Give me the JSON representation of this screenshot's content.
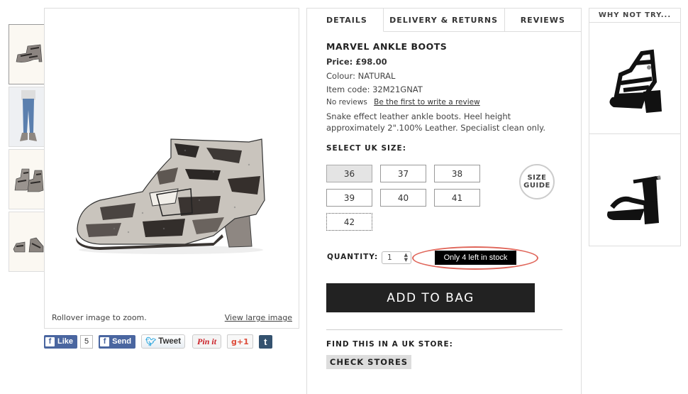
{
  "gallery": {
    "thumbnails": [
      {
        "name": "thumb-boot-side"
      },
      {
        "name": "thumb-model-legs"
      },
      {
        "name": "thumb-boot-pair"
      },
      {
        "name": "thumb-boot-front"
      }
    ],
    "rollover_text": "Rollover image to zoom.",
    "view_large_label": "View large image"
  },
  "social": {
    "like_label": "Like",
    "like_count": "5",
    "send_label": "Send",
    "tweet_label": "Tweet",
    "pin_label": "Pin it",
    "gplus_label": "g+1",
    "tumblr_label": "t"
  },
  "tabs": [
    "DETAILS",
    "DELIVERY & RETURNS",
    "REVIEWS"
  ],
  "product": {
    "name": "MARVEL ANKLE BOOTS",
    "price": "Price: £98.00",
    "colour": "Colour: NATURAL",
    "item_code": "Item code: 32M21GNAT",
    "no_reviews": "No reviews",
    "write_review": "Be the first to write a review",
    "description": "Snake effect leather ankle boots. Heel height approximately 2\".100% Leather. Specialist clean only."
  },
  "size": {
    "label": "SELECT UK SIZE:",
    "options": [
      "36",
      "37",
      "38",
      "39",
      "40",
      "41",
      "42"
    ],
    "selected": "36",
    "guide_line1": "SIZE",
    "guide_line2": "GUIDE"
  },
  "quantity": {
    "label": "QUANTITY:",
    "value": "1",
    "stock_text": "Only 4 left in stock"
  },
  "add_to_bag": "ADD TO BAG",
  "store": {
    "label": "FIND THIS IN A UK STORE:",
    "button": "CHECK STORES"
  },
  "why_not_try": {
    "title": "WHY NOT TRY...",
    "items": [
      {
        "name": "black-gladiator-platform"
      },
      {
        "name": "black-platform-sandal"
      }
    ]
  },
  "colors": {
    "accent_dark": "#222222",
    "stock_ring": "#e0665a",
    "facebook": "#4a66a0",
    "tumblr": "#34526f"
  }
}
